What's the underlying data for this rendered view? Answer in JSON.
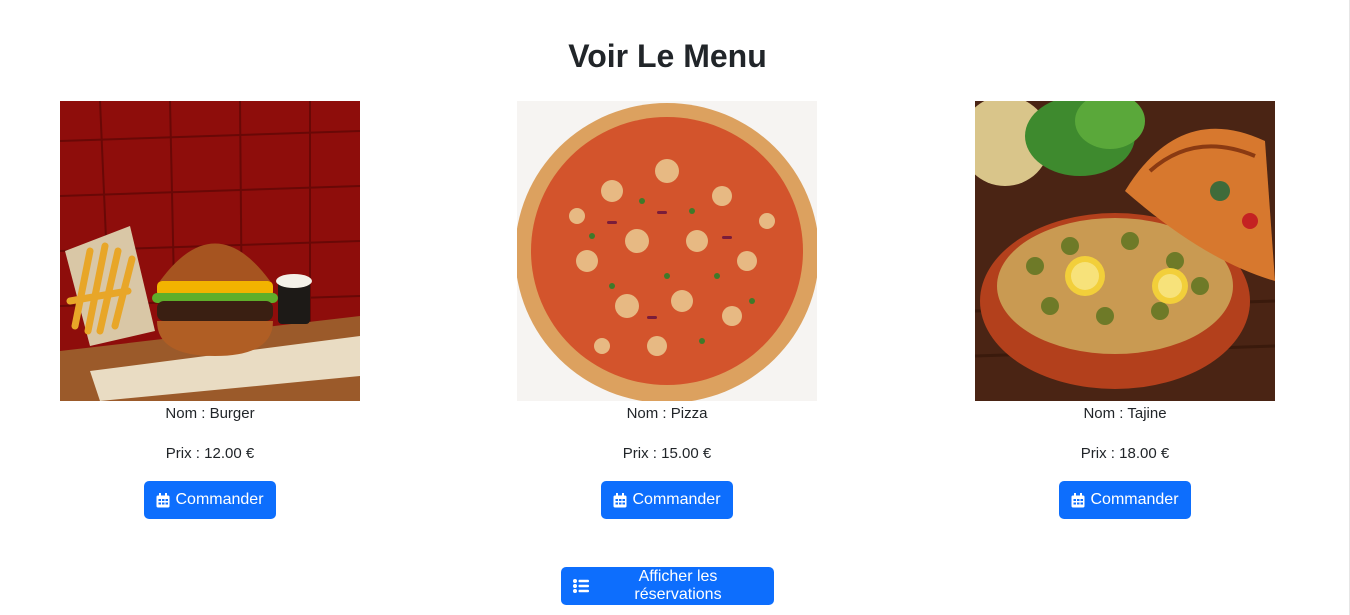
{
  "page": {
    "title": "Voir Le Menu"
  },
  "menu": {
    "items": [
      {
        "image": "burger-with-fries-photo",
        "name_text": "Nom : Burger",
        "price_text": "Prix : 12.00 €",
        "order_label": "Commander"
      },
      {
        "image": "pizza-photo",
        "name_text": "Nom : Pizza",
        "price_text": "Prix : 15.00 €",
        "order_label": "Commander"
      },
      {
        "image": "tajine-photo",
        "name_text": "Nom : Tajine",
        "price_text": "Prix : 18.00 €",
        "order_label": "Commander"
      }
    ]
  },
  "actions": {
    "reservations_label": "Afficher les réservations"
  },
  "icons": {
    "order_icon": "calendar-icon",
    "reservations_icon": "list-icon"
  },
  "colors": {
    "primary": "#0d6efd",
    "text": "#212529",
    "background": "#ffffff"
  }
}
